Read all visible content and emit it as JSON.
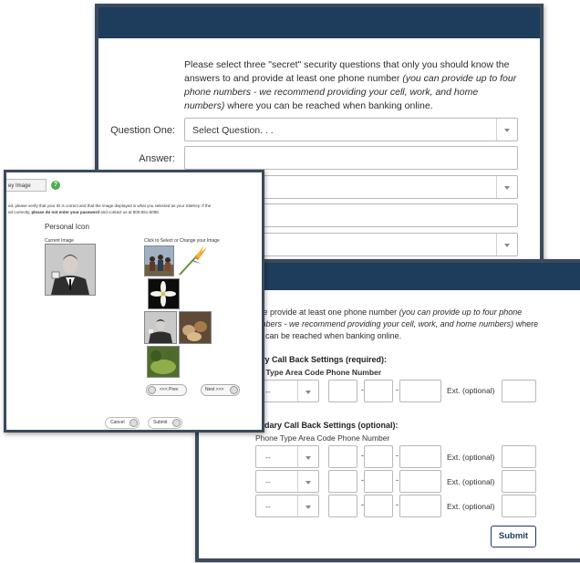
{
  "questions_window": {
    "intro_plain": "Please select three \"secret\" security questions that only you should know the answers to and provide at least one phone number ",
    "intro_italic": "(you can provide up to four phone numbers - we recommend providing your cell, work, and home numbers)",
    "intro_tail": " where you can be reached when banking online.",
    "question_one_label": "Question One:",
    "question_one_value": "Select Question. . .",
    "answer_label": "Answer:",
    "answer_value": ""
  },
  "sitekey_window": {
    "tab_label": "ey Image",
    "help_icon": "?",
    "note_plain": "ed, please verify that your ID is correct and that the image displayed is what you selected as your SiteKey. If the",
    "note_line2_plain": "ed correctly, ",
    "note_bold": "please do not enter your password",
    "note_tail": " and contact us at 800-551-6098.",
    "personal_icon": "Personal Icon",
    "current_image": "Current Image",
    "click_to_select": "Click to Select or Change your Image",
    "prev": "<<< Prev",
    "next": "Next >>>",
    "cancel": "Cancel",
    "submit": "Submit"
  },
  "callback_window": {
    "intro_plain": "ease provide at least one phone number ",
    "intro_italic": "(you can provide up to four phone numbers - we recommend providing your cell, work, and home numbers)",
    "intro_tail": " where you can be reached when banking online.",
    "primary_heading": "mary Call Back Settings (required):",
    "primary_columns": "one Type Area Code Phone Number",
    "primary_placeholder": "--",
    "secondary_heading": "condary Call Back Settings (optional):",
    "secondary_columns": "Phone Type Area Code Phone Number",
    "ext_label": "Ext. (optional)",
    "dash": "-",
    "rows": [
      {
        "phone_type": "--"
      },
      {
        "phone_type": "--"
      },
      {
        "phone_type": "--"
      }
    ],
    "submit": "Submit"
  },
  "colors": {
    "header_bar": "#1e3c5c",
    "window_border": "#3b4a5c",
    "help_green": "#4caf50"
  }
}
